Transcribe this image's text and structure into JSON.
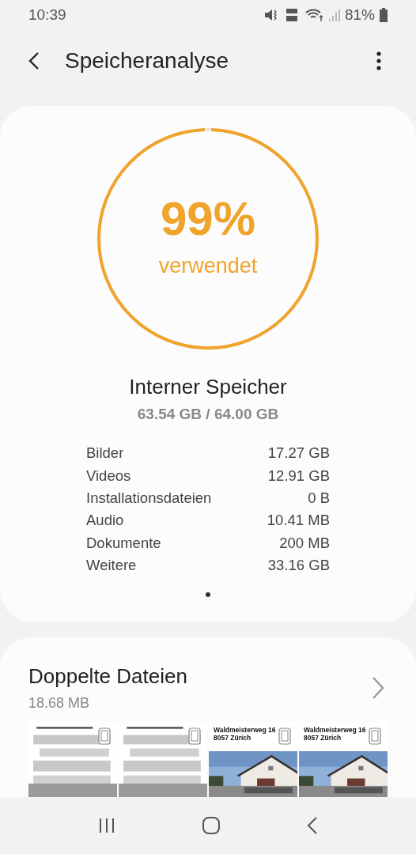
{
  "status_bar": {
    "time": "10:39",
    "battery": "81%"
  },
  "header": {
    "title": "Speicheranalyse"
  },
  "storage": {
    "percent": "99%",
    "caption": "verwendet",
    "level": 0.99,
    "name": "Interner Speicher",
    "usage": "63.54 GB / 64.00 GB",
    "categories": [
      {
        "label": "Bilder",
        "size": "17.27 GB"
      },
      {
        "label": "Videos",
        "size": "12.91 GB"
      },
      {
        "label": "Installationsdateien",
        "size": "0 B"
      },
      {
        "label": "Audio",
        "size": "10.41 MB"
      },
      {
        "label": "Dokumente",
        "size": "200 MB"
      },
      {
        "label": "Weitere",
        "size": "33.16 GB"
      }
    ]
  },
  "duplicates": {
    "title": "Doppelte Dateien",
    "size": "18.68 MB",
    "thumbnails": [
      {
        "kind": "document"
      },
      {
        "kind": "document"
      },
      {
        "kind": "listing",
        "heading": "Waldmeisterweg 16",
        "subheading": "8057 Zürich"
      },
      {
        "kind": "listing",
        "heading": "Waldmeisterweg 16",
        "subheading": "8057 Zürich"
      }
    ]
  }
}
